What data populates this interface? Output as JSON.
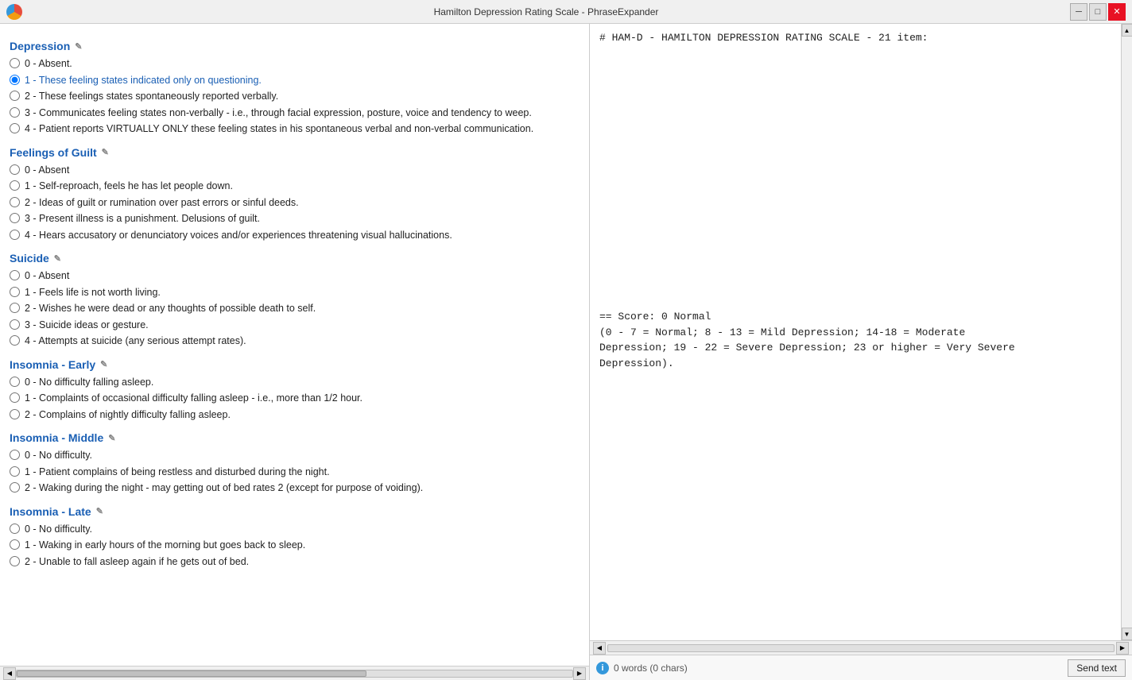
{
  "window": {
    "title": "Hamilton Depression Rating Scale - PhraseExpander",
    "minimize_label": "─",
    "restore_label": "□",
    "close_label": "✕"
  },
  "sections": [
    {
      "id": "depression",
      "label": "Depression",
      "items": [
        {
          "value": "0",
          "label": "0 - Absent.",
          "selected": false
        },
        {
          "value": "1",
          "label": "1 - These feeling states indicated only on questioning.",
          "selected": true
        },
        {
          "value": "2",
          "label": "2 - These feelings states spontaneously reported verbally.",
          "selected": false
        },
        {
          "value": "3",
          "label": "3 - Communicates feeling states non-verbally - i.e., through facial expression, posture, voice and tendency to weep.",
          "selected": false
        },
        {
          "value": "4",
          "label": "4 - Patient reports VIRTUALLY ONLY these feeling states in his spontaneous verbal and non-verbal communication.",
          "selected": false
        }
      ]
    },
    {
      "id": "guilt",
      "label": "Feelings of Guilt",
      "items": [
        {
          "value": "0",
          "label": "0 - Absent",
          "selected": false
        },
        {
          "value": "1",
          "label": "1 - Self-reproach, feels he has let people down.",
          "selected": false
        },
        {
          "value": "2",
          "label": "2 - Ideas of guilt or rumination over past errors or sinful deeds.",
          "selected": false
        },
        {
          "value": "3",
          "label": "3 - Present illness is a punishment. Delusions of guilt.",
          "selected": false
        },
        {
          "value": "4",
          "label": "4 - Hears accusatory or denunciatory voices and/or experiences threatening visual hallucinations.",
          "selected": false
        }
      ]
    },
    {
      "id": "suicide",
      "label": "Suicide",
      "items": [
        {
          "value": "0",
          "label": "0 - Absent",
          "selected": false
        },
        {
          "value": "1",
          "label": "1 - Feels life is not worth living.",
          "selected": false
        },
        {
          "value": "2",
          "label": "2 - Wishes he were dead or any thoughts of possible death to self.",
          "selected": false
        },
        {
          "value": "3",
          "label": "3 - Suicide ideas or gesture.",
          "selected": false
        },
        {
          "value": "4",
          "label": "4 - Attempts at suicide (any serious attempt rates).",
          "selected": false
        }
      ]
    },
    {
      "id": "insomnia-early",
      "label": "Insomnia - Early",
      "items": [
        {
          "value": "0",
          "label": "0 - No difficulty falling asleep.",
          "selected": false
        },
        {
          "value": "1",
          "label": "1 - Complaints of occasional difficulty falling asleep - i.e., more than 1/2 hour.",
          "selected": false
        },
        {
          "value": "2",
          "label": "2 - Complains of nightly difficulty falling asleep.",
          "selected": false
        }
      ]
    },
    {
      "id": "insomnia-middle",
      "label": "Insomnia - Middle",
      "items": [
        {
          "value": "0",
          "label": "0 - No difficulty.",
          "selected": false
        },
        {
          "value": "1",
          "label": "1 - Patient complains of being restless and disturbed during the night.",
          "selected": false
        },
        {
          "value": "2",
          "label": "2 - Waking during the night - may getting out of bed rates 2 (except for purpose of voiding).",
          "selected": false
        }
      ]
    },
    {
      "id": "insomnia-late",
      "label": "Insomnia - Late",
      "items": [
        {
          "value": "0",
          "label": "0 - No difficulty.",
          "selected": false
        },
        {
          "value": "1",
          "label": "1 - Waking in early hours of the morning but goes back to sleep.",
          "selected": false
        },
        {
          "value": "2",
          "label": "2 - Unable to fall asleep again if he gets out of bed.",
          "selected": false
        }
      ]
    }
  ],
  "textarea_content": "# HAM-D - HAMILTON DEPRESSION RATING SCALE - 21 item:\n\n\n\n\n\n\n\n\n\n\n\n\n\n\n\n\n\n== Score: 0 Normal\n(0 - 7 = Normal; 8 - 13 = Mild Depression; 14-18 = Moderate\nDepression; 19 - 22 = Severe Depression; 23 or higher = Very Severe\nDepression).",
  "status": {
    "info_icon": "i",
    "word_count": "0 words (0 chars)"
  },
  "buttons": {
    "send_text": "Send text"
  }
}
